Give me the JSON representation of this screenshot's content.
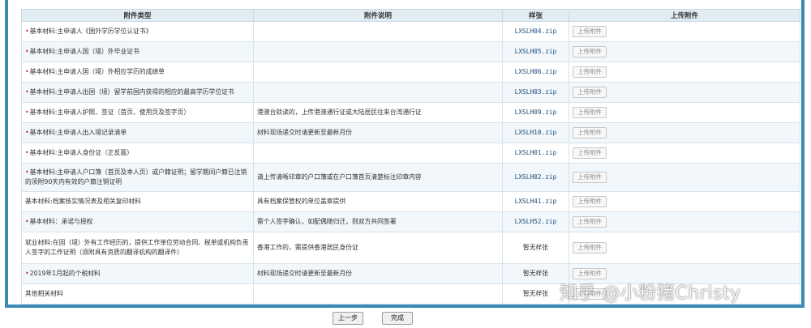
{
  "table": {
    "headers": [
      "附件类型",
      "附件说明",
      "样张",
      "上传附件"
    ],
    "upload_label": "上传附件",
    "rows": [
      {
        "required": true,
        "type": "基本材料:主申请人《国外学历学位认证书》",
        "desc": "",
        "sample": "LXSLH04.zip"
      },
      {
        "required": true,
        "type": "基本材料:主申请人国（境）外毕业证书",
        "desc": "",
        "sample": "LXSLH05.zip"
      },
      {
        "required": true,
        "type": "基本材料:主申请人国（境）外相应学历的成绩单",
        "desc": "",
        "sample": "LXSLH06.zip"
      },
      {
        "required": true,
        "type": "基本材料:主申请人出国（境）留学前国内获得的相应的最高学历学位证书",
        "desc": "",
        "sample": "LXSLH03.zip"
      },
      {
        "required": true,
        "type": "基本材料:主申请人护照、签证（首页、使用页及签字页）",
        "desc": "港澳台就读的，上传港澳通行证或大陆居民往来台湾通行证",
        "sample": "LXSLH09.zip"
      },
      {
        "required": true,
        "type": "基本材料:主申请人出入境记录清单",
        "desc": "材料现场递交时请更新至最新月份",
        "sample": "LXSLH10.zip"
      },
      {
        "required": true,
        "type": "基本材料:主申请人身份证（正反面）",
        "desc": "",
        "sample": "LXSLH01.zip"
      },
      {
        "required": true,
        "type": "基本材料:主申请人户口簿（首页及本人页）或户籍证明；留学期间户籍已注销的须附90天内有效的户籍注销证明",
        "desc": "请上传清晰印章的户口簿或在户口簿首页清楚标注印章内容",
        "sample": "LXSLH02.zip"
      },
      {
        "required": false,
        "type": "基本材料:档案核实情况表及相关复印材料",
        "desc": "具有档案保管权的单位盖章提供",
        "sample": "LXSLH41.zip"
      },
      {
        "required": true,
        "type": "基本材料：承诺与授权",
        "desc": "需个人签字确认，如配偶随归迁，则双方共同签署",
        "sample": "LXSLH52.zip"
      },
      {
        "required": false,
        "type": "就业材料:在国（境）外有工作经历的，提供工作单位劳动合同、税单或机构负责人签字的工作证明（须附具有资质的翻译机构的翻译件）",
        "desc": "香港工作的，需提供香港居民身份证",
        "sample": "暂无样张"
      },
      {
        "required": true,
        "type": "2019年1月起的个税材料",
        "desc": "材料现场递交时请更新至最新月份",
        "sample": "暂无样张"
      },
      {
        "required": false,
        "type": "其他相关材料",
        "desc": "",
        "sample": "暂无样张"
      }
    ]
  },
  "nav": {
    "prev_label": "上一步",
    "done_label": "完成"
  },
  "watermark": "知乎 @小粉猪Christy",
  "colors": {
    "frame_border": "#3a8ab4",
    "header_bg": "#e1ecf3",
    "required_star": "#d02020",
    "sample_link": "#1f4f7a"
  }
}
